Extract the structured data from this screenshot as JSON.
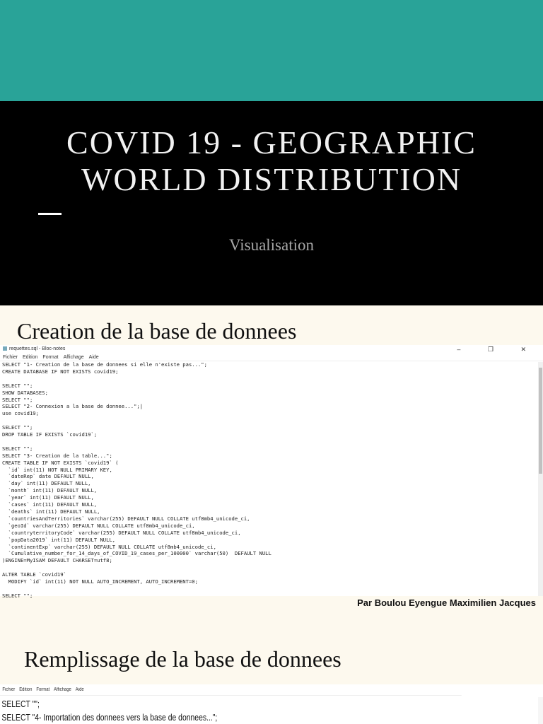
{
  "hero": {
    "title_line1": "COVID 19 - GEOGRAPHIC",
    "title_line2": "WORLD DISTRIBUTION",
    "subtitle": "Visualisation"
  },
  "section1": {
    "heading": "Creation de la base de donnees",
    "window": {
      "title": "requettes.sql - Bloc-notes",
      "controls": "– ❐ ✕",
      "menu": [
        "Fichier",
        "Edition",
        "Format",
        "Affichage",
        "Aide"
      ],
      "lines": [
        "SELECT \"1- Creation de la base de donnees si elle n'existe pas...\";",
        "CREATE DATABASE IF NOT EXISTS covid19;",
        "",
        "SELECT \"\";",
        "SHOW DATABASES;",
        "SELECT \"\";",
        "SELECT \"2- Connexion a la base de donnee...\";|",
        "use covid19;",
        "",
        "SELECT \"\";",
        "DROP TABLE IF EXISTS `covid19`;",
        "",
        "SELECT \"\";",
        "SELECT \"3- Creation de la table...\";",
        "CREATE TABLE IF NOT EXISTS `covid19` (",
        "  `id` int(11) NOT NULL PRIMARY KEY,",
        "  `dateRep` date DEFAULT NULL,",
        "  `day` int(11) DEFAULT NULL,",
        "  `month` int(11) DEFAULT NULL,",
        "  `year` int(11) DEFAULT NULL,",
        "  `cases` int(11) DEFAULT NULL,",
        "  `deaths` int(11) DEFAULT NULL,",
        "  `countriesAndTerritories` varchar(255) DEFAULT NULL COLLATE utf8mb4_unicode_ci,",
        "  `geoId` varchar(255) DEFAULT NULL COLLATE utf8mb4_unicode_ci,",
        "  `countryterritoryCode` varchar(255) DEFAULT NULL COLLATE utf8mb4_unicode_ci,",
        "  `popData2019` int(11) DEFAULT NULL,",
        "  `continentExp` varchar(255) DEFAULT NULL COLLATE utf8mb4_unicode_ci,",
        "  `Cumulative_number_for_14_days_of_COVID_19_cases_per_100000` varchar(50)  DEFAULT NULL",
        ")ENGINE=MyISAM DEFAULT CHARSET=utf8;",
        "",
        "ALTER TABLE `covid19`",
        "  MODIFY `id` int(11) NOT NULL AUTO_INCREMENT, AUTO_INCREMENT=0;",
        "",
        "SELECT \"\";"
      ]
    }
  },
  "credit": "Par Boulou Eyengue Maximilien Jacques",
  "section2": {
    "heading": "Remplissage de la base de donnees",
    "window": {
      "menu": [
        "Fichier",
        "Edition",
        "Format",
        "Affichage",
        "Aide"
      ],
      "lines": [
        "SELECT \"\";",
        "SELECT \"4- Importation des donnees vers la base de donnees...\";"
      ]
    }
  }
}
